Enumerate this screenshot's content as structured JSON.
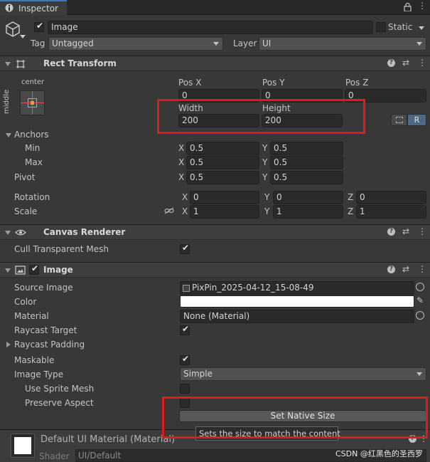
{
  "tab": {
    "icon": "info-icon",
    "label": "Inspector",
    "menu_icons": [
      "lock-icon",
      "more-icon"
    ]
  },
  "header": {
    "object_icon": "cube-icon",
    "active_checked": true,
    "name": "Image",
    "static_label": "Static",
    "tag_label": "Tag",
    "tag_value": "Untagged",
    "layer_label": "Layer",
    "layer_value": "UI"
  },
  "rect_transform": {
    "title": "Rect Transform",
    "anchor_preset_h": "center",
    "anchor_preset_v": "middle",
    "pos_x_label": "Pos X",
    "pos_y_label": "Pos Y",
    "pos_z_label": "Pos Z",
    "pos_x": "0",
    "pos_y": "0",
    "pos_z": "0",
    "width_label": "Width",
    "height_label": "Height",
    "width": "200",
    "height": "200",
    "raw_button": "R",
    "anchors_label": "Anchors",
    "min_label": "Min",
    "max_label": "Max",
    "min_x": "0.5",
    "min_y": "0.5",
    "max_x": "0.5",
    "max_y": "0.5",
    "pivot_label": "Pivot",
    "pivot_x": "0.5",
    "pivot_y": "0.5",
    "rotation_label": "Rotation",
    "rot_x": "0",
    "rot_y": "0",
    "rot_z": "0",
    "scale_label": "Scale",
    "scale_x": "1",
    "scale_y": "1",
    "scale_z": "1",
    "axis_x": "X",
    "axis_y": "Y",
    "axis_z": "Z"
  },
  "canvas_renderer": {
    "title": "Canvas Renderer",
    "cull_label": "Cull Transparent Mesh",
    "cull_checked": true
  },
  "image": {
    "title": "Image",
    "enabled": true,
    "source_image_label": "Source Image",
    "source_image_value": "PixPin_2025-04-12_15-08-49",
    "color_label": "Color",
    "color_value": "#ffffff",
    "material_label": "Material",
    "material_value": "None (Material)",
    "raycast_target_label": "Raycast Target",
    "raycast_target_checked": true,
    "raycast_padding_label": "Raycast Padding",
    "maskable_label": "Maskable",
    "maskable_checked": true,
    "image_type_label": "Image Type",
    "image_type_value": "Simple",
    "use_sprite_mesh_label": "Use Sprite Mesh",
    "preserve_aspect_label": "Preserve Aspect",
    "set_native_size_button": "Set Native Size",
    "tooltip": "Sets the size to match the content"
  },
  "material_preview": {
    "title": "Default UI Material (Material)",
    "shader_label": "Shader",
    "shader_value": "UI/Default"
  },
  "watermark": "CSDN @红黑色的圣西罗",
  "colors": {
    "accent": "#3a79bb",
    "highlight_box": "#e01b1b",
    "background": "#383838"
  }
}
